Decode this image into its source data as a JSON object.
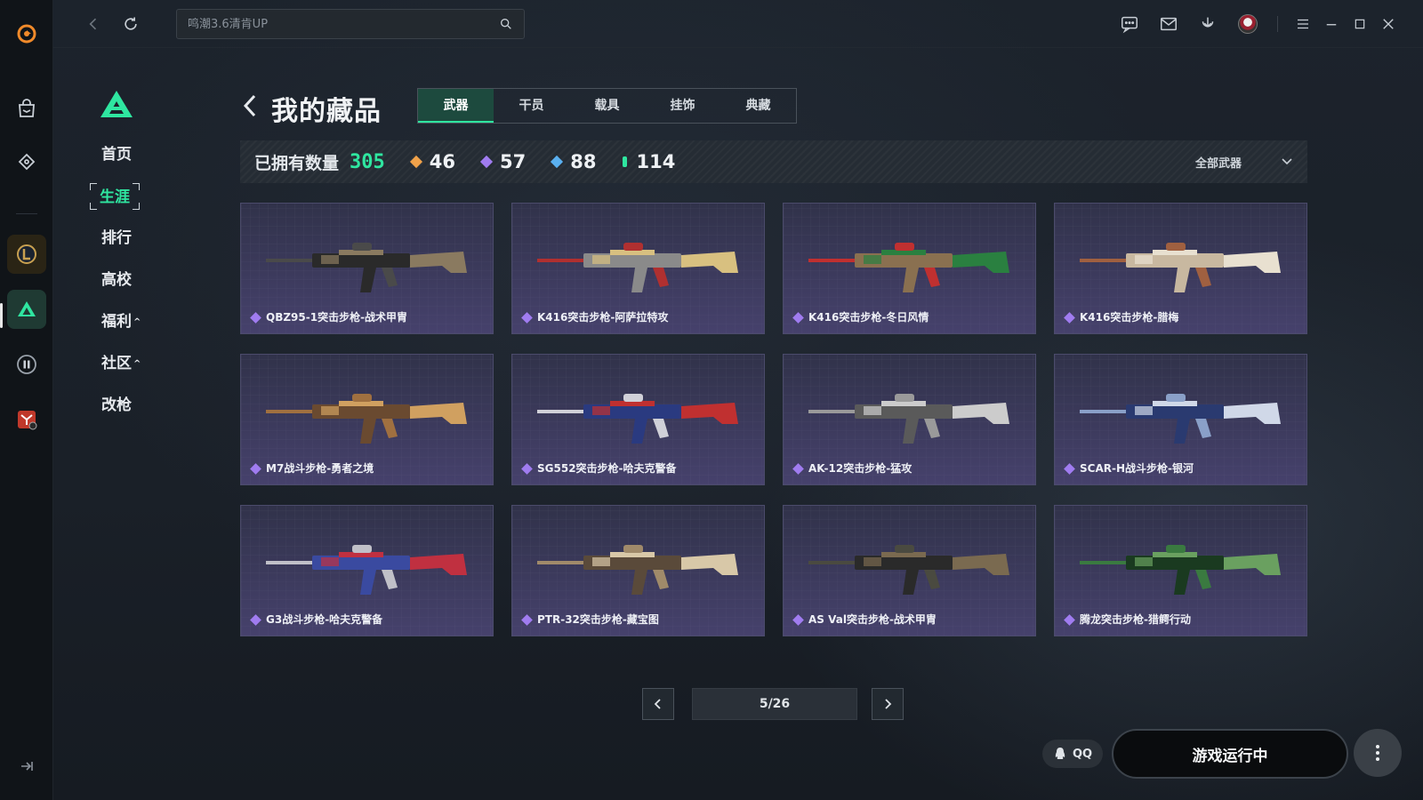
{
  "app": {
    "search_placeholder": "鸣潮3.6清肯UP"
  },
  "sidebar": {
    "items": [
      {
        "label": "首页",
        "active": false
      },
      {
        "label": "生涯",
        "active": true
      },
      {
        "label": "排行",
        "active": false
      },
      {
        "label": "高校",
        "active": false
      },
      {
        "label": "福利",
        "active": false,
        "caret": "^"
      },
      {
        "label": "社区",
        "active": false,
        "caret": "^"
      },
      {
        "label": "改枪",
        "active": false
      }
    ]
  },
  "header": {
    "title": "我的藏品",
    "tabs": [
      {
        "label": "武器",
        "active": true
      },
      {
        "label": "干员",
        "active": false
      },
      {
        "label": "载具",
        "active": false
      },
      {
        "label": "挂饰",
        "active": false
      },
      {
        "label": "典藏",
        "active": false
      }
    ]
  },
  "stats": {
    "owned_label": "已拥有数量",
    "owned_total": "305",
    "tiers": [
      {
        "value": "46",
        "color": "#f0a24a"
      },
      {
        "value": "57",
        "color": "#a07cf0"
      },
      {
        "value": "88",
        "color": "#5ab0f0"
      },
      {
        "value": "114",
        "color": "#2fe6a0"
      }
    ],
    "filter_label": "全部武器"
  },
  "weapons": [
    {
      "name": "QBZ95-1突击步枪-战术甲胄",
      "palette": [
        "#2a2a2a",
        "#4a4a4a",
        "#8a7a60"
      ]
    },
    {
      "name": "K416突击步枪-阿萨拉特攻",
      "palette": [
        "#8a8a8a",
        "#b03030",
        "#d8c080"
      ]
    },
    {
      "name": "K416突击步枪-冬日风情",
      "palette": [
        "#8a7050",
        "#c03030",
        "#2a8040"
      ]
    },
    {
      "name": "K416突击步枪-腊梅",
      "palette": [
        "#c8b8a0",
        "#a06040",
        "#e8e0d0"
      ]
    },
    {
      "name": "M7战斗步枪-勇者之境",
      "palette": [
        "#6a4a30",
        "#a07040",
        "#d0a060"
      ]
    },
    {
      "name": "SG552突击步枪-哈夫克警备",
      "palette": [
        "#2a3a80",
        "#d0d0d8",
        "#c03030"
      ]
    },
    {
      "name": "AK-12突击步枪-猛攻",
      "palette": [
        "#5a5a5a",
        "#9a9a9a",
        "#cccccc"
      ]
    },
    {
      "name": "SCAR-H战斗步枪-银河",
      "palette": [
        "#2a3a70",
        "#8aa0c8",
        "#d0d8e8"
      ]
    },
    {
      "name": "G3战斗步枪-哈夫克警备",
      "palette": [
        "#3a4aa0",
        "#c0c0c8",
        "#c03040"
      ]
    },
    {
      "name": "PTR-32突击步枪-藏宝图",
      "palette": [
        "#5a4a3a",
        "#a08a6a",
        "#d8c8a8"
      ]
    },
    {
      "name": "AS Val突击步枪-战术甲胄",
      "palette": [
        "#2a2a2a",
        "#4a4a40",
        "#7a6a50"
      ]
    },
    {
      "name": "腾龙突击步枪-猎鳄行动",
      "palette": [
        "#1a3a20",
        "#3a7a40",
        "#6aa060"
      ]
    }
  ],
  "pagination": {
    "label": "5/26"
  },
  "bottom": {
    "qq_label": "QQ",
    "run_label": "游戏运行中"
  }
}
